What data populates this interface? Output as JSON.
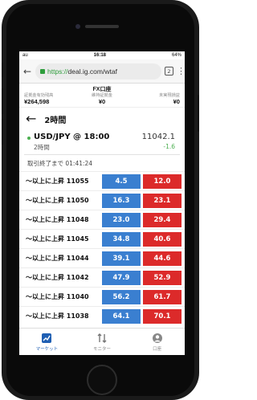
{
  "status_bar": {
    "carrier": "au",
    "time": "16:18",
    "battery": "64%"
  },
  "browser": {
    "url_prefix": "https://",
    "url_host": "deal.ig.com/wtaf",
    "tab_count": "2"
  },
  "account": {
    "title": "FX口座",
    "cols": [
      {
        "label": "証拠金有効残高",
        "value": "¥264,598"
      },
      {
        "label": "維持証拠金",
        "value": "¥0"
      },
      {
        "label": "未実現損益",
        "value": "¥0"
      }
    ]
  },
  "page": {
    "title": "2時間"
  },
  "instrument": {
    "name": "USD/JPY @ 18:00",
    "sub": "2時間",
    "price": "11042.1",
    "change": "-1.6"
  },
  "countdown": "取引終了まで 01:41:24",
  "rows": [
    {
      "label": "〜以上に上昇 11055",
      "bid": "4.5",
      "ask": "12.0"
    },
    {
      "label": "〜以上に上昇 11050",
      "bid": "16.3",
      "ask": "23.1"
    },
    {
      "label": "〜以上に上昇 11048",
      "bid": "23.0",
      "ask": "29.4"
    },
    {
      "label": "〜以上に上昇 11045",
      "bid": "34.8",
      "ask": "40.6"
    },
    {
      "label": "〜以上に上昇 11044",
      "bid": "39.1",
      "ask": "44.6"
    },
    {
      "label": "〜以上に上昇 11042",
      "bid": "47.9",
      "ask": "52.9"
    },
    {
      "label": "〜以上に上昇 11040",
      "bid": "56.2",
      "ask": "61.7"
    },
    {
      "label": "〜以上に上昇 11038",
      "bid": "64.1",
      "ask": "70.1"
    }
  ],
  "bottom_nav": [
    {
      "label": "マーケット",
      "icon": "market-chart-icon"
    },
    {
      "label": "モニター",
      "icon": "monitor-arrows-icon"
    },
    {
      "label": "口座",
      "icon": "account-user-icon"
    }
  ],
  "colors": {
    "bid": "#3a7fd0",
    "ask": "#dc2a2a",
    "positive": "#4caf50",
    "nav_active": "#1f5fb3"
  }
}
